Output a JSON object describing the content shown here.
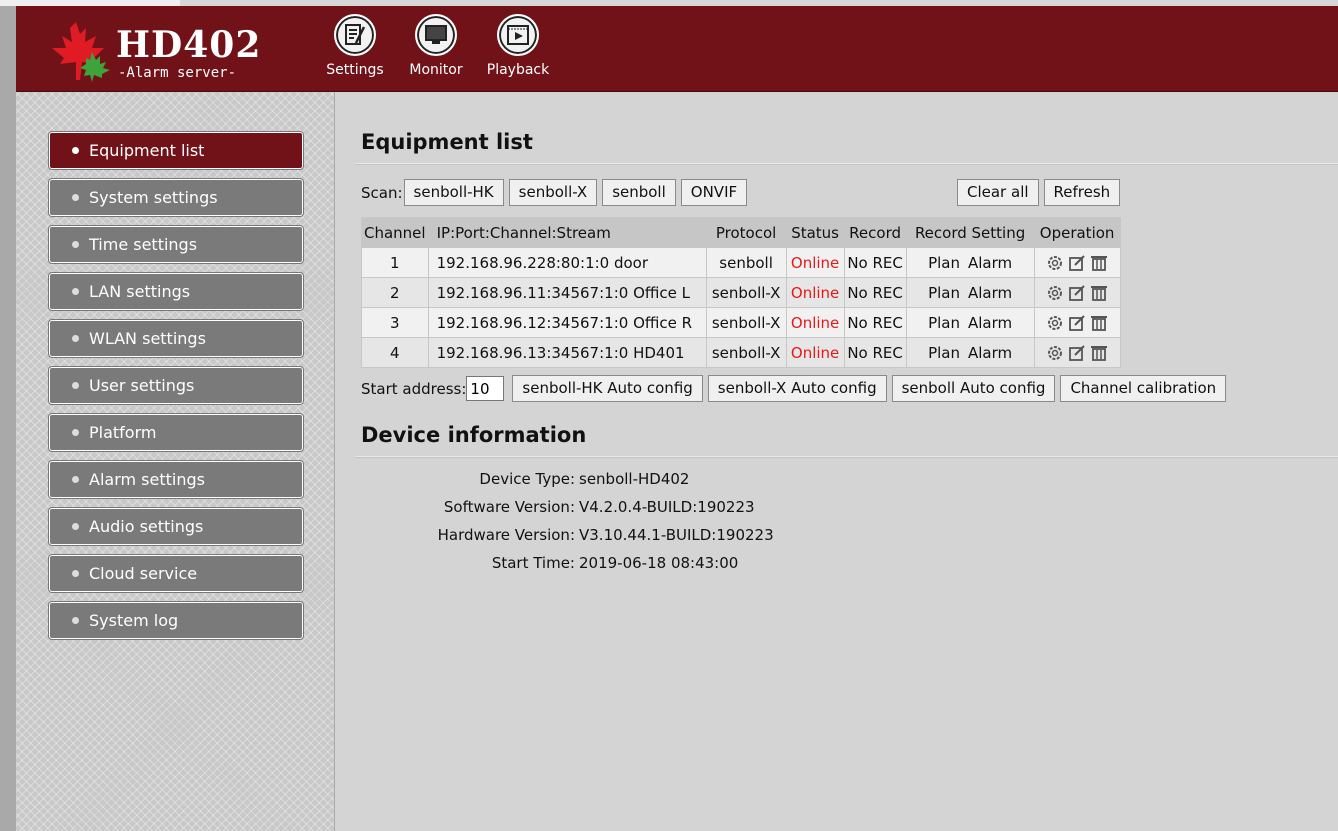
{
  "header": {
    "logo_title": "HD402",
    "logo_subtitle": "-Alarm server-",
    "nav": [
      {
        "label": "Settings",
        "icon": "settings-icon"
      },
      {
        "label": "Monitor",
        "icon": "monitor-icon"
      },
      {
        "label": "Playback",
        "icon": "playback-icon"
      }
    ]
  },
  "sidebar": {
    "items": [
      {
        "label": "Equipment list",
        "active": true
      },
      {
        "label": "System settings"
      },
      {
        "label": "Time settings"
      },
      {
        "label": "LAN settings"
      },
      {
        "label": "WLAN settings"
      },
      {
        "label": "User settings"
      },
      {
        "label": "Platform"
      },
      {
        "label": "Alarm settings"
      },
      {
        "label": "Audio settings"
      },
      {
        "label": "Cloud service"
      },
      {
        "label": "System log"
      }
    ]
  },
  "equipment": {
    "title": "Equipment list",
    "scan_label": "Scan:",
    "scan_buttons": [
      "senboll-HK",
      "senboll-X",
      "senboll",
      "ONVIF"
    ],
    "clear_all": "Clear all",
    "refresh": "Refresh",
    "columns": [
      "Channel",
      "IP:Port:Channel:Stream",
      "Protocol",
      "Status",
      "Record",
      "Record Setting",
      "Operation"
    ],
    "rows": [
      {
        "channel": "1",
        "ip": "192.168.96.228:80:1:0 door",
        "protocol": "senboll",
        "status": "Online",
        "record": "No REC",
        "plan": "Plan",
        "alarm": "Alarm"
      },
      {
        "channel": "2",
        "ip": "192.168.96.11:34567:1:0 Office L",
        "protocol": "senboll-X",
        "status": "Online",
        "record": "No REC",
        "plan": "Plan",
        "alarm": "Alarm"
      },
      {
        "channel": "3",
        "ip": "192.168.96.12:34567:1:0 Office R",
        "protocol": "senboll-X",
        "status": "Online",
        "record": "No REC",
        "plan": "Plan",
        "alarm": "Alarm"
      },
      {
        "channel": "4",
        "ip": "192.168.96.13:34567:1:0 HD401",
        "protocol": "senboll-X",
        "status": "Online",
        "record": "No REC",
        "plan": "Plan",
        "alarm": "Alarm"
      }
    ],
    "start_address_label": "Start address:",
    "start_address_value": "10",
    "config_buttons": [
      "senboll-HK Auto config",
      "senboll-X Auto config",
      "senboll Auto config",
      "Channel calibration"
    ]
  },
  "device": {
    "title": "Device information",
    "items": [
      {
        "label": "Device Type:",
        "value": "senboll-HD402"
      },
      {
        "label": "Software Version:",
        "value": "V4.2.0.4-BUILD:190223"
      },
      {
        "label": "Hardware Version:",
        "value": "V3.10.44.1-BUILD:190223"
      },
      {
        "label": "Start Time:",
        "value": "2019-06-18 08:43:00"
      }
    ]
  },
  "colors": {
    "brand": "#711219",
    "status_online": "#e61919"
  }
}
